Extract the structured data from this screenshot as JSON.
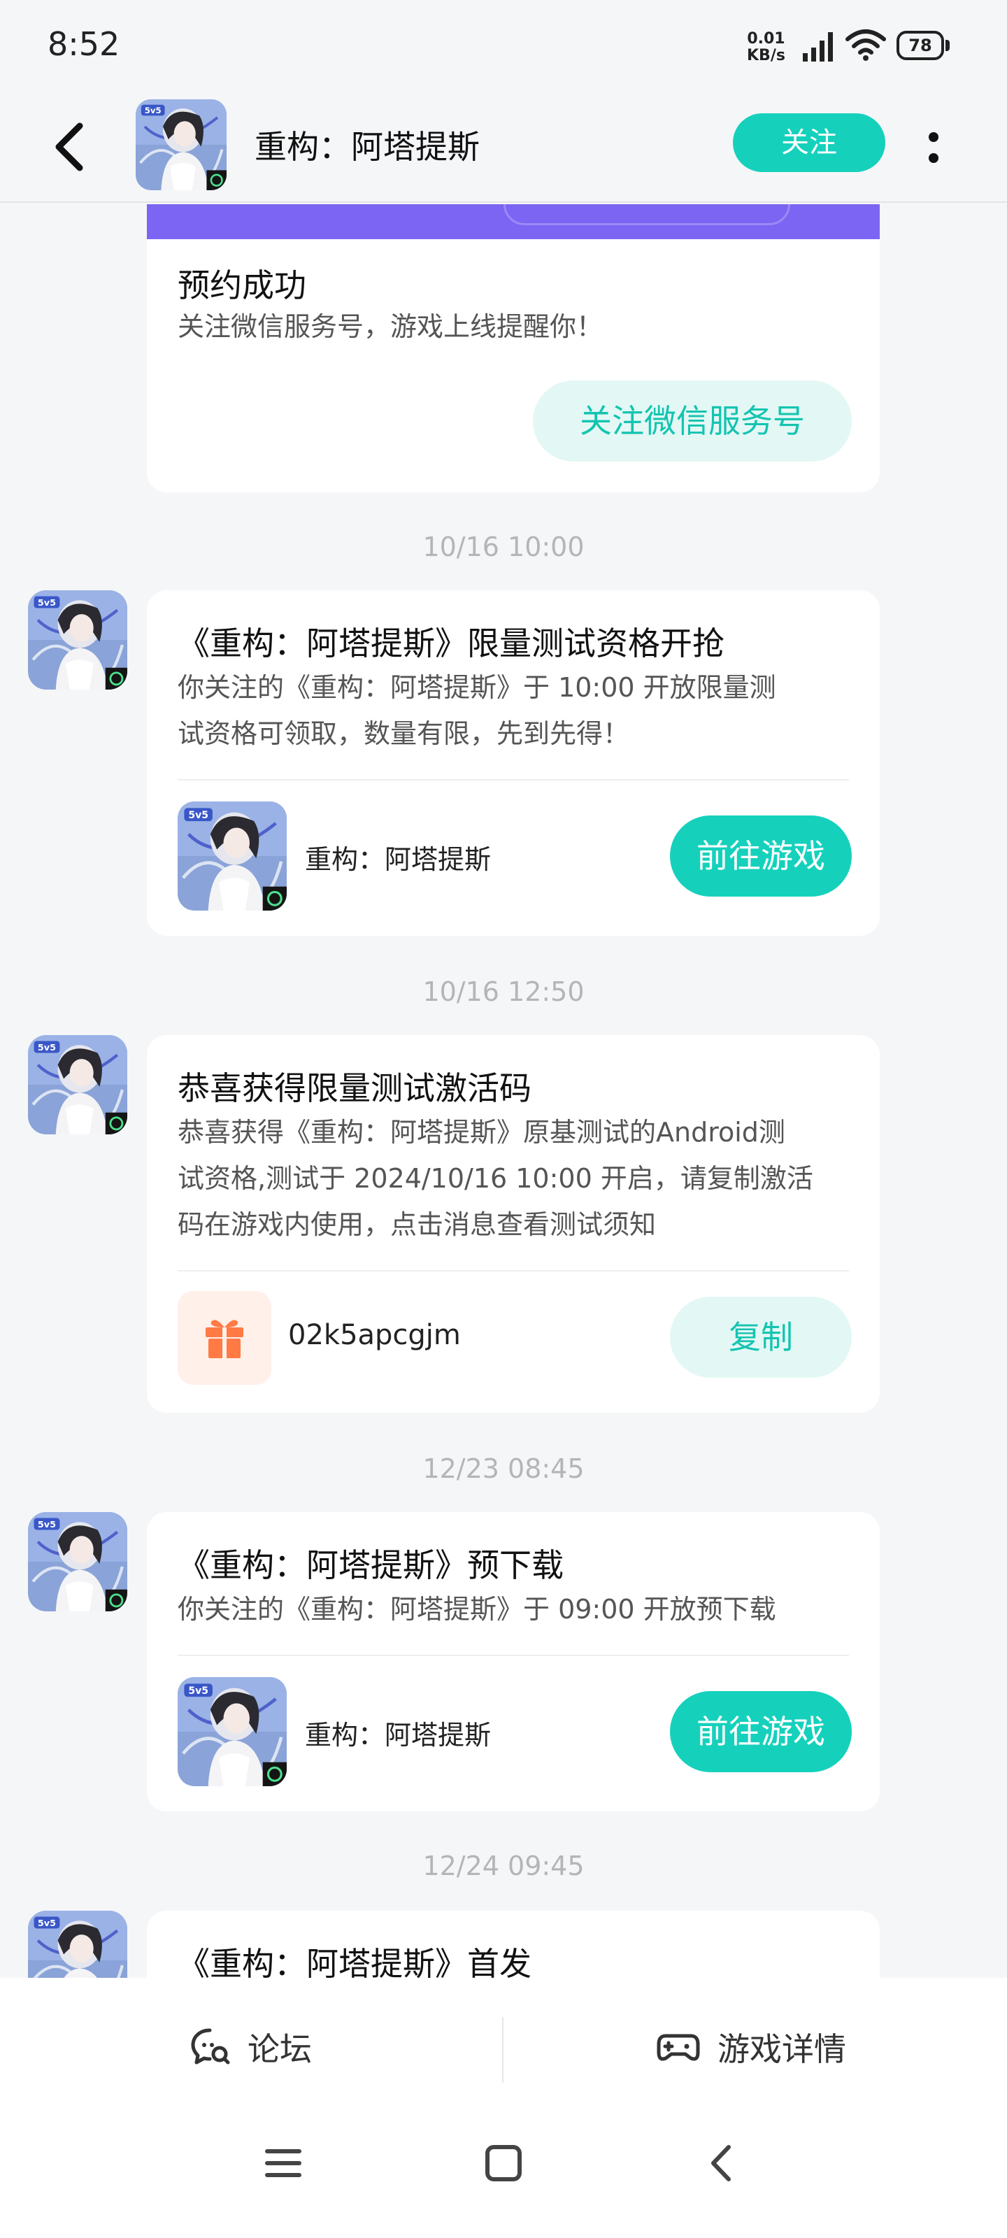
{
  "status_bar": {
    "time": "8:52",
    "net_speed_value": "0.01",
    "net_speed_unit": "KB/s",
    "battery": "78"
  },
  "header": {
    "title": "重构：阿塔提斯",
    "follow_label": "关注"
  },
  "colors": {
    "accent": "#15d1bc",
    "banner": "#7b65f2",
    "gift": "#ff7a45"
  },
  "messages": [
    {
      "title": "预约成功",
      "body": "关注微信服务号，游戏上线提醒你！",
      "action_label": "关注微信服务号"
    },
    {
      "timestamp": "10/16  10:00",
      "title": "《重构：阿塔提斯》限量测试资格开抢",
      "body_line1": "你关注的《重构：阿塔提斯》于 10:00 开放限量测",
      "body_line2": "试资格可领取，数量有限，先到先得！",
      "game_name": "重构：阿塔提斯",
      "action_label": "前往游戏"
    },
    {
      "timestamp": "10/16  12:50",
      "title": "恭喜获得限量测试激活码",
      "body_line1": "恭喜获得《重构：阿塔提斯》原基测试的Android测",
      "body_line2": "试资格,测试于 2024/10/16 10:00 开启，请复制激活",
      "body_line3": "码在游戏内使用，点击消息查看测试须知",
      "code": "02k5apcgjm",
      "action_label": "复制"
    },
    {
      "timestamp": "12/23  08:45",
      "title": "《重构：阿塔提斯》预下载",
      "body_line1": "你关注的《重构：阿塔提斯》于 09:00 开放预下载",
      "game_name": "重构：阿塔提斯",
      "action_label": "前往游戏"
    },
    {
      "timestamp": "12/24  09:45",
      "title": "《重构：阿塔提斯》首发"
    }
  ],
  "bottom_bar": {
    "forum_label": "论坛",
    "details_label": "游戏详情"
  },
  "icons": [
    "back-icon",
    "more-icon",
    "forum-icon",
    "gamepad-icon",
    "gift-icon",
    "menu-icon",
    "home-icon",
    "nav-back-icon"
  ]
}
